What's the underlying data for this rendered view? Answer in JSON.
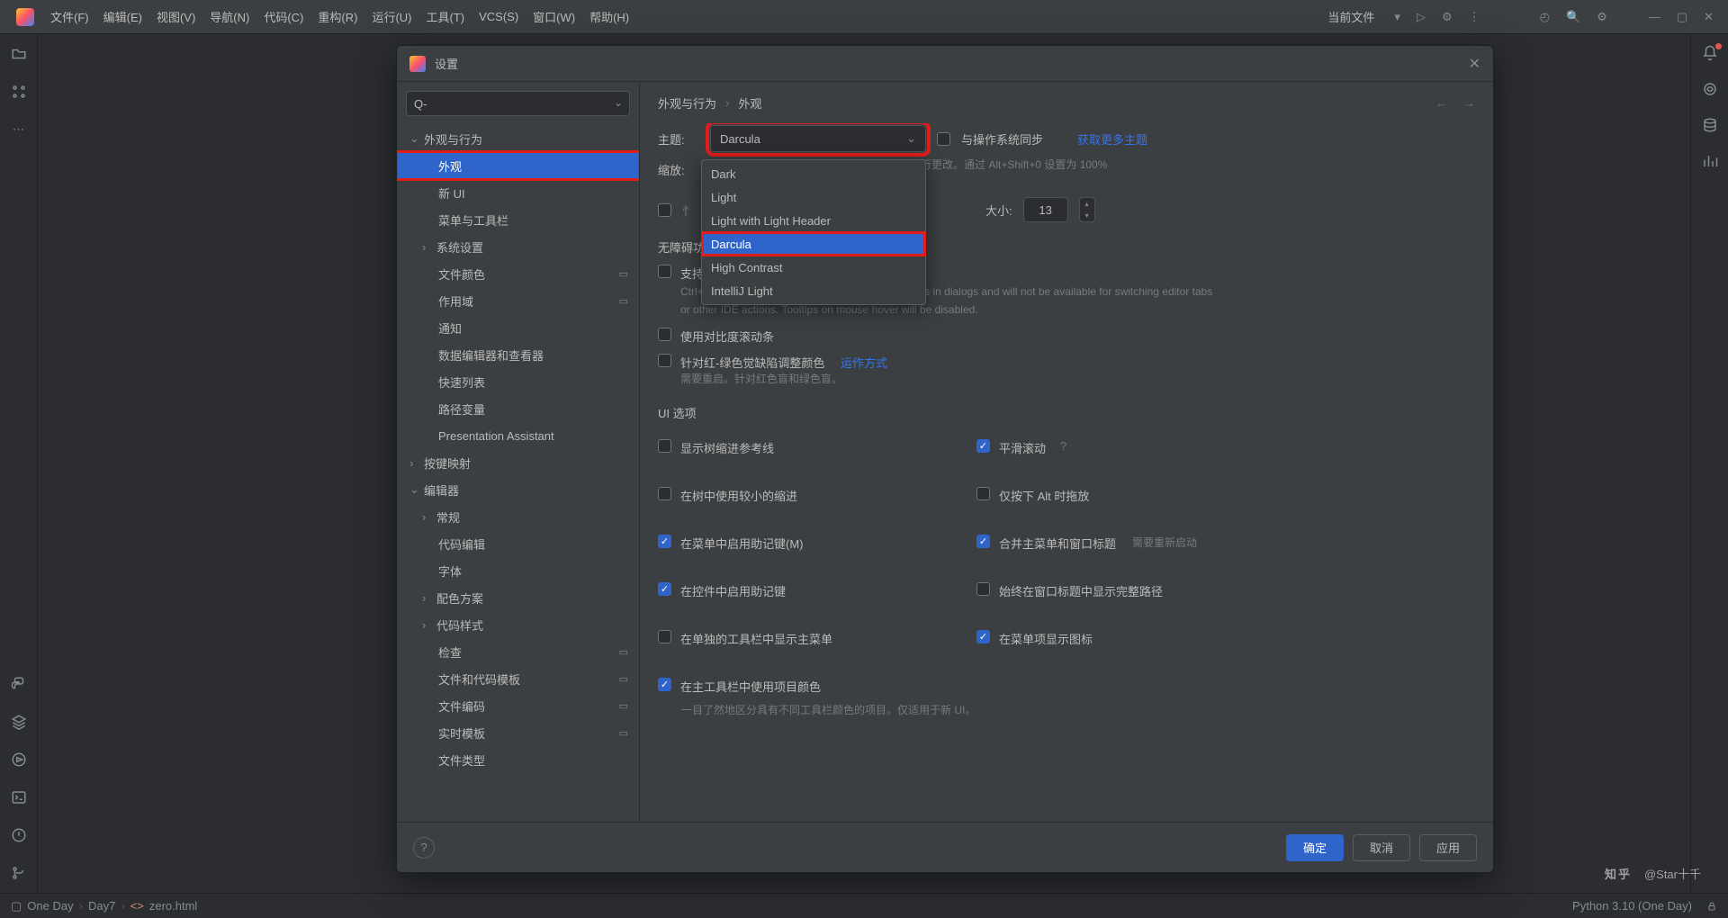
{
  "menubar": {
    "items": [
      "文件(F)",
      "编辑(E)",
      "视图(V)",
      "导航(N)",
      "代码(C)",
      "重构(R)",
      "运行(U)",
      "工具(T)",
      "VCS(S)",
      "窗口(W)",
      "帮助(H)"
    ],
    "current_file": "当前文件"
  },
  "statusbar": {
    "crumbs": [
      "One Day",
      "Day7",
      "zero.html"
    ],
    "interpreter": "Python 3.10 (One Day)"
  },
  "dialog": {
    "title": "设置",
    "search_placeholder": "Q-",
    "footer": {
      "ok": "确定",
      "cancel": "取消",
      "apply": "应用"
    },
    "tree": [
      {
        "label": "外观与行为",
        "level": 0,
        "expanded": true
      },
      {
        "label": "外观",
        "level": 2,
        "selected": true,
        "redring": true
      },
      {
        "label": "新 UI",
        "level": 2
      },
      {
        "label": "菜单与工具栏",
        "level": 2
      },
      {
        "label": "系统设置",
        "level": 1,
        "chev": true
      },
      {
        "label": "文件颜色",
        "level": 2,
        "badge": true
      },
      {
        "label": "作用域",
        "level": 2,
        "badge": true
      },
      {
        "label": "通知",
        "level": 2
      },
      {
        "label": "数据编辑器和查看器",
        "level": 2
      },
      {
        "label": "快速列表",
        "level": 2
      },
      {
        "label": "路径变量",
        "level": 2
      },
      {
        "label": "Presentation Assistant",
        "level": 2
      },
      {
        "label": "按键映射",
        "level": 0
      },
      {
        "label": "编辑器",
        "level": 0,
        "expanded": true
      },
      {
        "label": "常规",
        "level": 1,
        "chev": true
      },
      {
        "label": "代码编辑",
        "level": 2
      },
      {
        "label": "字体",
        "level": 2
      },
      {
        "label": "配色方案",
        "level": 1,
        "chev": true
      },
      {
        "label": "代码样式",
        "level": 1,
        "chev": true
      },
      {
        "label": "检查",
        "level": 2,
        "badge": true
      },
      {
        "label": "文件和代码模板",
        "level": 2,
        "badge": true
      },
      {
        "label": "文件编码",
        "level": 2,
        "badge": true
      },
      {
        "label": "实时模板",
        "level": 2,
        "badge": true
      },
      {
        "label": "文件类型",
        "level": 2
      }
    ],
    "content": {
      "breadcrumb": [
        "外观与行为",
        "外观"
      ],
      "theme_label": "主题:",
      "theme_value": "Darcula",
      "theme_options": [
        "Dark",
        "Light",
        "Light with Light Header",
        "Darcula",
        "High Contrast",
        "IntelliJ Light"
      ],
      "sync_os": "与操作系统同步",
      "get_more_themes": "获取更多主题",
      "zoom_label": "缩放:",
      "zoom_hint": "进行更改。通过 Alt+Shift+0 设置为 100%",
      "font_size_label": "大小:",
      "font_size_value": "13",
      "a11y_title": "无障碍功能",
      "screen_reader": "支持屏幕阅读器",
      "needs_restart": "需要重新启动",
      "screen_reader_hint": "Ctrl+Tab and Ctrl+Shift+Tab will navigate UI controls in dialogs and will not be available for switching editor tabs or other IDE actions. Tooltips on mouse hover will be disabled.",
      "contrast_scrollbar": "使用对比度滚动条",
      "colorblind": "针对红-绿色觉缺陷调整颜色",
      "how_it_works": "运作方式",
      "colorblind_hint": "需要重启。针对红色盲和绿色盲。",
      "ui_options_title": "UI 选项",
      "left_opts": [
        {
          "label": "显示树缩进参考线",
          "checked": false
        },
        {
          "label": "在树中使用较小的缩进",
          "checked": false
        },
        {
          "label": "在菜单中启用助记键(M)",
          "checked": true
        },
        {
          "label": "在控件中启用助记键",
          "checked": true
        },
        {
          "label": "在单独的工具栏中显示主菜单",
          "checked": false
        },
        {
          "label": "在主工具栏中使用项目颜色",
          "checked": true
        }
      ],
      "project_color_hint": "一目了然地区分具有不同工具栏颜色的项目。仅适用于新 UI。",
      "right_opts": [
        {
          "label": "平滑滚动",
          "checked": true,
          "help": true
        },
        {
          "label": "仅按下 Alt 时拖放",
          "checked": false
        },
        {
          "label": "合并主菜单和窗口标题",
          "checked": true,
          "restart": true
        },
        {
          "label": "始终在窗口标题中显示完整路径",
          "checked": false
        },
        {
          "label": "在菜单项显示图标",
          "checked": true
        }
      ]
    }
  },
  "watermark": "@Star十千"
}
